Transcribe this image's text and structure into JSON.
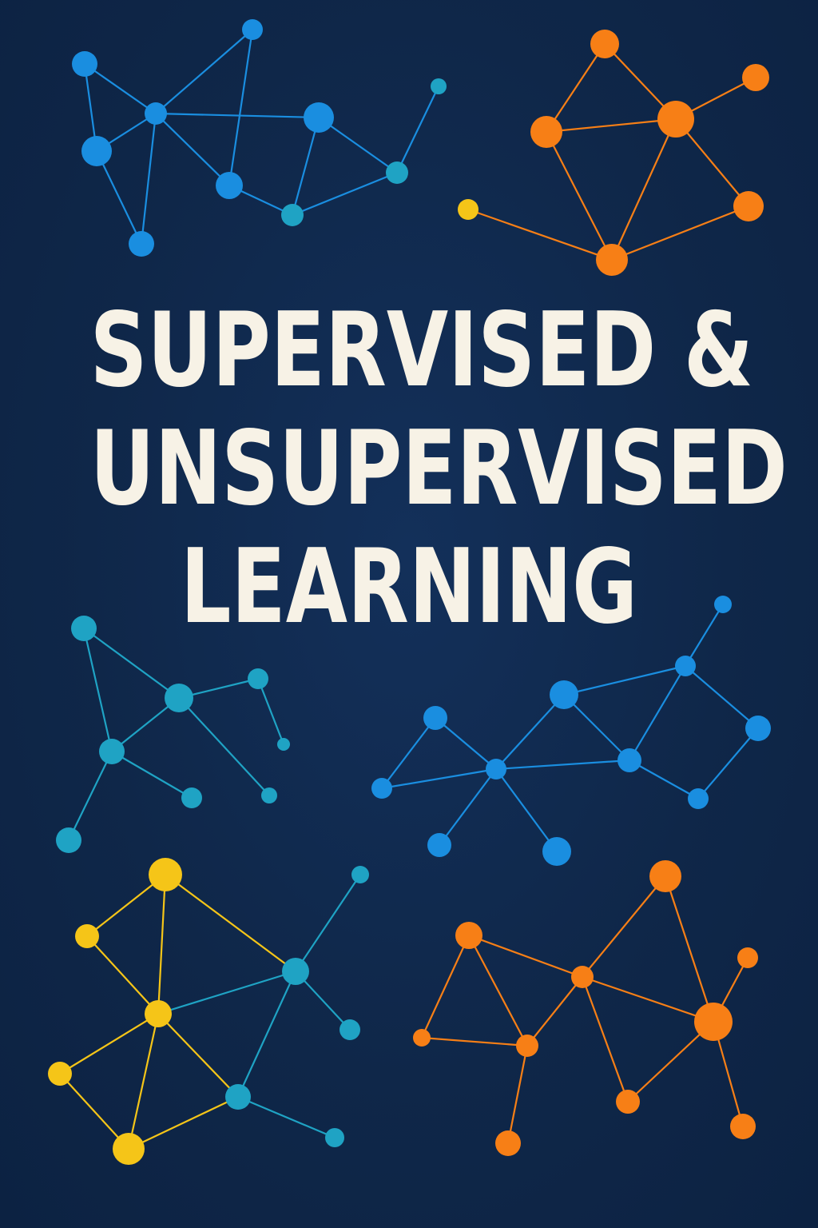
{
  "title": {
    "lines": [
      "SUPERVISED &",
      "UNSUPERVISED",
      "LEARNING"
    ]
  },
  "colors": {
    "background": "#0f2749",
    "title_text": "#f7f2e6",
    "blue": "#1a8ee0",
    "teal": "#1fa3c4",
    "orange": "#f77f16",
    "yellow": "#f5c518"
  },
  "decoration": {
    "motif": "network-graph-icons",
    "count": 6
  }
}
